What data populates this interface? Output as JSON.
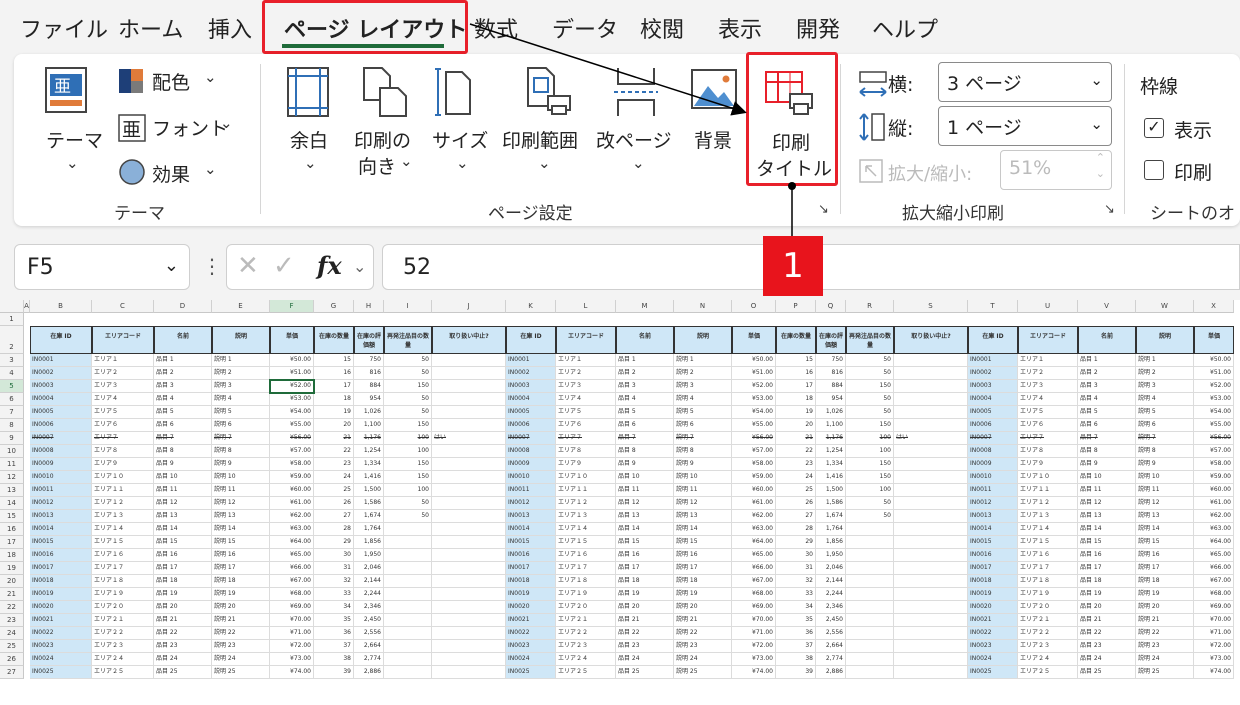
{
  "menu": {
    "items": [
      "ファイル",
      "ホーム",
      "挿入",
      "ページ レイアウト",
      "数式",
      "データ",
      "校閲",
      "表示",
      "開発",
      "ヘルプ"
    ],
    "active_index": 3
  },
  "ribbon": {
    "theme_group": {
      "theme_label": "テーマ",
      "colors_label": "配色",
      "fonts_label": "フォント",
      "effects_label": "効果",
      "group_label": "テーマ"
    },
    "page_setup": {
      "margins_label": "余白",
      "orientation_label_1": "印刷の",
      "orientation_label_2": "向き",
      "size_label": "サイズ",
      "print_area_label": "印刷範囲",
      "breaks_label": "改ページ",
      "background_label": "背景",
      "print_titles_label_1": "印刷",
      "print_titles_label_2": "タイトル",
      "group_label": "ページ設定"
    },
    "scale_to_fit": {
      "width_label": "横:",
      "width_value": "3 ページ",
      "height_label": "縦:",
      "height_value": "1 ページ",
      "scale_label": "拡大/縮小:",
      "scale_value": "51%",
      "group_label": "拡大縮小印刷"
    },
    "sheet_options": {
      "gridlines_label": "枠線",
      "view_label": "表示",
      "print_label": "印刷",
      "group_label": "シートのオ"
    }
  },
  "formula_bar": {
    "name_box": "F5",
    "fx_symbol": "fx",
    "value": "52"
  },
  "annotation": {
    "step": "1"
  },
  "sheet": {
    "columns": [
      "A",
      "B",
      "C",
      "D",
      "E",
      "F",
      "G",
      "H",
      "I",
      "J",
      "K",
      "L",
      "M",
      "N",
      "O",
      "P",
      "Q",
      "R",
      "S",
      "T",
      "U",
      "V",
      "W",
      "X"
    ],
    "headers": [
      "在庫 ID",
      "エリアコード",
      "名前",
      "説明",
      "単価",
      "在庫の数量",
      "在庫の評価額",
      "再発注品目の数量",
      "取り扱い中止?"
    ],
    "rows": [
      [
        "IN0001",
        "エリア１",
        "品目 1",
        "説明 1",
        "¥50.00",
        "15",
        "750",
        "50",
        ""
      ],
      [
        "IN0002",
        "エリア２",
        "品目 2",
        "説明 2",
        "¥51.00",
        "16",
        "816",
        "50",
        ""
      ],
      [
        "IN0003",
        "エリア３",
        "品目 3",
        "説明 3",
        "¥52.00",
        "17",
        "884",
        "150",
        ""
      ],
      [
        "IN0004",
        "エリア４",
        "品目 4",
        "説明 4",
        "¥53.00",
        "18",
        "954",
        "50",
        ""
      ],
      [
        "IN0005",
        "エリア５",
        "品目 5",
        "説明 5",
        "¥54.00",
        "19",
        "1,026",
        "50",
        ""
      ],
      [
        "IN0006",
        "エリア６",
        "品目 6",
        "説明 6",
        "¥55.00",
        "20",
        "1,100",
        "150",
        ""
      ],
      [
        "IN0007",
        "エリア７",
        "品目 7",
        "説明 7",
        "¥56.00",
        "21",
        "1,176",
        "100",
        "はい"
      ],
      [
        "IN0008",
        "エリア８",
        "品目 8",
        "説明 8",
        "¥57.00",
        "22",
        "1,254",
        "100",
        ""
      ],
      [
        "IN0009",
        "エリア９",
        "品目 9",
        "説明 9",
        "¥58.00",
        "23",
        "1,334",
        "150",
        ""
      ],
      [
        "IN0010",
        "エリア１０",
        "品目 10",
        "説明 10",
        "¥59.00",
        "24",
        "1,416",
        "150",
        ""
      ],
      [
        "IN0011",
        "エリア１１",
        "品目 11",
        "説明 11",
        "¥60.00",
        "25",
        "1,500",
        "100",
        ""
      ],
      [
        "IN0012",
        "エリア１２",
        "品目 12",
        "説明 12",
        "¥61.00",
        "26",
        "1,586",
        "50",
        ""
      ],
      [
        "IN0013",
        "エリア１３",
        "品目 13",
        "説明 13",
        "¥62.00",
        "27",
        "1,674",
        "50",
        ""
      ],
      [
        "IN0014",
        "エリア１４",
        "品目 14",
        "説明 14",
        "¥63.00",
        "28",
        "1,764",
        "",
        ""
      ],
      [
        "IN0015",
        "エリア１５",
        "品目 15",
        "説明 15",
        "¥64.00",
        "29",
        "1,856",
        "",
        ""
      ],
      [
        "IN0016",
        "エリア１６",
        "品目 16",
        "説明 16",
        "¥65.00",
        "30",
        "1,950",
        "",
        ""
      ],
      [
        "IN0017",
        "エリア１７",
        "品目 17",
        "説明 17",
        "¥66.00",
        "31",
        "2,046",
        "",
        ""
      ],
      [
        "IN0018",
        "エリア１８",
        "品目 18",
        "説明 18",
        "¥67.00",
        "32",
        "2,144",
        "",
        ""
      ],
      [
        "IN0019",
        "エリア１９",
        "品目 19",
        "説明 19",
        "¥68.00",
        "33",
        "2,244",
        "",
        ""
      ],
      [
        "IN0020",
        "エリア２０",
        "品目 20",
        "説明 20",
        "¥69.00",
        "34",
        "2,346",
        "",
        ""
      ],
      [
        "IN0021",
        "エリア２１",
        "品目 21",
        "説明 21",
        "¥70.00",
        "35",
        "2,450",
        "",
        ""
      ],
      [
        "IN0022",
        "エリア２２",
        "品目 22",
        "説明 22",
        "¥71.00",
        "36",
        "2,556",
        "",
        ""
      ],
      [
        "IN0023",
        "エリア２３",
        "品目 23",
        "説明 23",
        "¥72.00",
        "37",
        "2,664",
        "",
        ""
      ],
      [
        "IN0024",
        "エリア２４",
        "品目 24",
        "説明 24",
        "¥73.00",
        "38",
        "2,774",
        "",
        ""
      ],
      [
        "IN0025",
        "エリア２５",
        "品目 25",
        "説明 25",
        "¥74.00",
        "39",
        "2,886",
        "",
        ""
      ]
    ],
    "strike_row_index": 6,
    "row_numbers": [
      "1",
      "2",
      "3",
      "4",
      "5",
      "6",
      "7",
      "8",
      "9",
      "10",
      "11",
      "12",
      "13",
      "14",
      "15",
      "16",
      "17",
      "18",
      "19",
      "20",
      "21",
      "22",
      "23",
      "24",
      "25",
      "26",
      "27"
    ]
  }
}
